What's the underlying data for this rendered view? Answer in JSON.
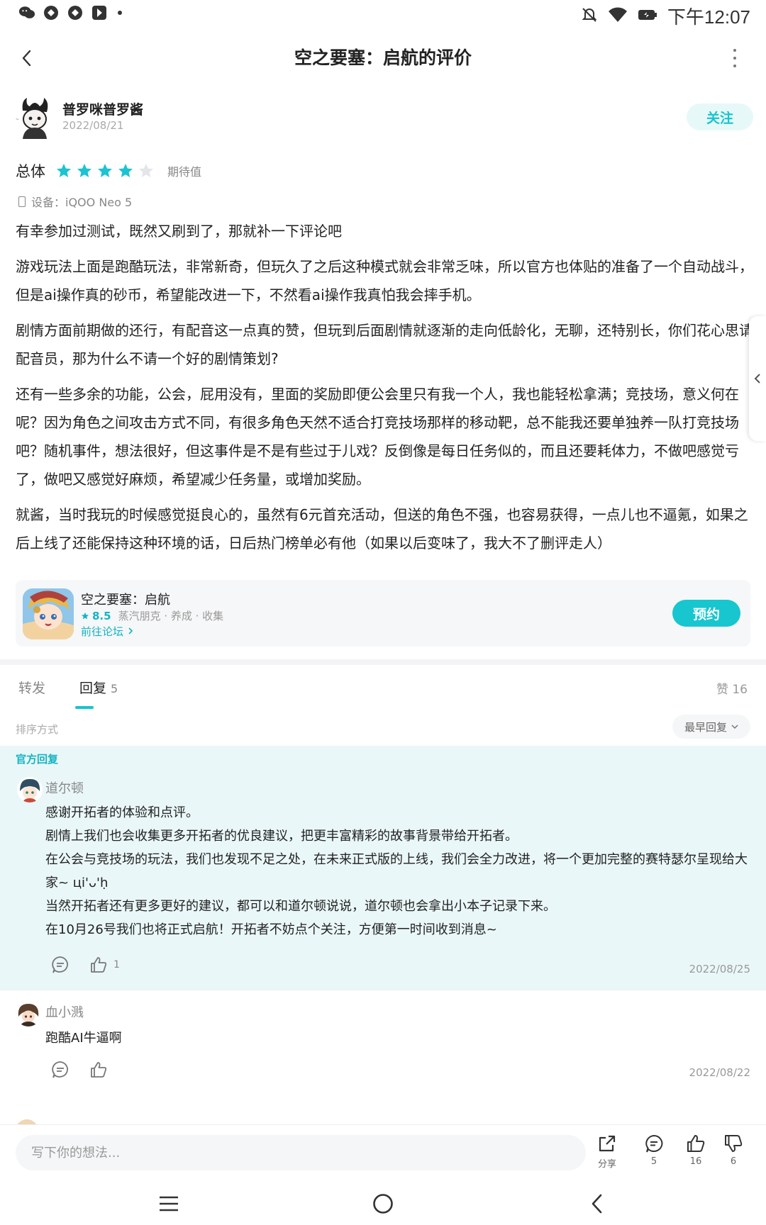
{
  "statusbar": {
    "time": "下午12:07"
  },
  "header": {
    "title": "空之要塞：启航的评价"
  },
  "author": {
    "name": "普罗咪普罗酱",
    "date": "2022/08/21",
    "follow_label": "关注"
  },
  "rating": {
    "label": "总体",
    "stars": 4,
    "max_stars": 5,
    "tag": "期待值",
    "star_color": "#1cc3d0"
  },
  "device": {
    "text": "设备：iQOO Neo 5"
  },
  "review": {
    "paragraphs": [
      "有幸参加过测试，既然又刷到了，那就补一下评论吧",
      "游戏玩法上面是跑酷玩法，非常新奇，但玩久了之后这种模式就会非常乏味，所以官方也体贴的准备了一个自动战斗，但是ai操作真的砂币，希望能改进一下，不然看ai操作我真怕我会摔手机。",
      "剧情方面前期做的还行，有配音这一点真的赞，但玩到后面剧情就逐渐的走向低龄化，无聊，还特别长，你们花心思请配音员，那为什么不请一个好的剧情策划?",
      "还有一些多余的功能，公会，屁用没有，里面的奖励即便公会里只有我一个人，我也能轻松拿满；竞技场，意义何在呢？因为角色之间攻击方式不同，有很多角色天然不适合打竞技场那样的移动靶，总不能我还要单独养一队打竞技场吧？随机事件，想法很好，但这事件是不是有些过于儿戏？反倒像是每日任务似的，而且还要耗体力，不做吧感觉亏了，做吧又感觉好麻烦，希望减少任务量，或增加奖励。",
      "就酱，当时我玩的时候感觉挺良心的，虽然有6元首充活动，但送的角色不强，也容易获得，一点儿也不逼氪，如果之后上线了还能保持这种环境的话，日后热门榜单必有他（如果以后变味了，我大不了删评走人）"
    ]
  },
  "game_card": {
    "name": "空之要塞：启航",
    "score": "8.5",
    "tags": "蒸汽朋克 · 养成 · 收集",
    "forum_link": "前往论坛",
    "reserve_label": "预约"
  },
  "tabs": {
    "repost": "转发",
    "replies": "回复",
    "replies_count": "5",
    "likes": "赞 16"
  },
  "sort": {
    "label": "排序方式",
    "value": "最早回复"
  },
  "official_reply": {
    "tag": "官方回复",
    "name": "道尔顿",
    "lines": [
      "感谢开拓者的体验和点评。",
      "剧情上我们也会收集更多开拓者的优良建议，把更丰富精彩的故事背景带给开拓者。",
      "在公会与竞技场的玩法，我们也发现不足之处，在未来正式版的上线，我们会全力改进，将一个更加完整的赛特瑟尔呈现给大家~ ці'ᴗ'ḥ",
      "当然开拓者还有更多更好的建议，都可以和道尔顿说说，道尔顿也会拿出小本子记录下来。",
      "在10月26号我们也将正式启航！开拓者不妨点个关注，方便第一时间收到消息~"
    ],
    "like_count": "1",
    "date": "2022/08/25"
  },
  "reply2": {
    "name": "血小溅",
    "text": "跑酷AI牛逼啊",
    "date": "2022/08/22"
  },
  "bottom_bar": {
    "placeholder": "写下你的想法...",
    "share_label": "分享",
    "comment_count": "5",
    "like_count": "16",
    "dislike_count": "6"
  }
}
